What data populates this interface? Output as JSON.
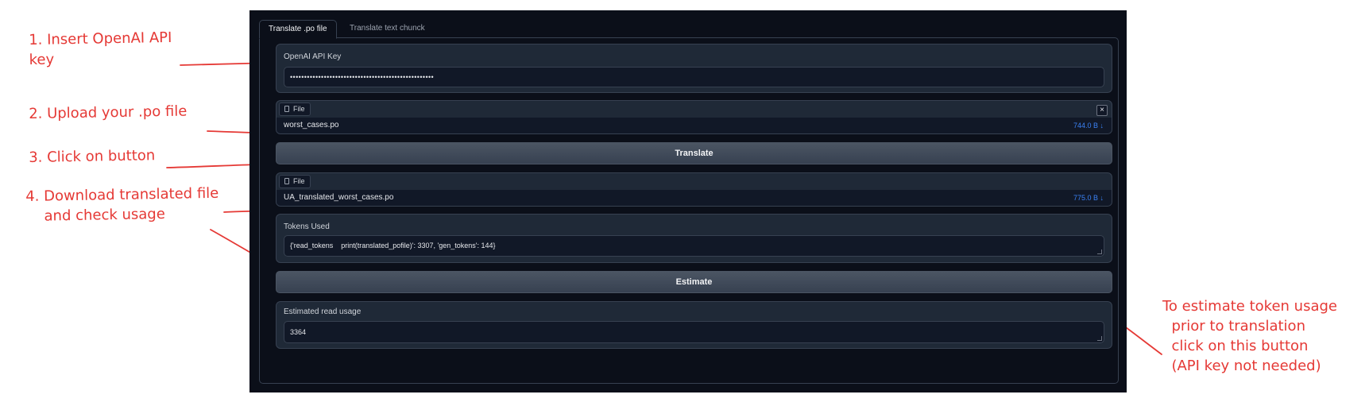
{
  "tabs": [
    {
      "label": "Translate .po file",
      "active": true
    },
    {
      "label": "Translate text chunck",
      "active": false
    }
  ],
  "api_key": {
    "label": "OpenAI API Key",
    "value": "•••••••••••••••••••••••••••••••••••••••••••••••••••"
  },
  "upload": {
    "chip_label": "File",
    "filename": "worst_cases.po",
    "size": "744.0 B ↓",
    "close": "×"
  },
  "translate_button": "Translate",
  "download": {
    "chip_label": "File",
    "filename": "UA_translated_worst_cases.po",
    "size": "775.0 B ↓"
  },
  "tokens": {
    "label": "Tokens Used",
    "value": "{'read_tokens    print(translated_pofile)': 3307, 'gen_tokens': 144}"
  },
  "estimate_button": "Estimate",
  "estimated": {
    "label": "Estimated read usage",
    "value": "3364"
  },
  "annotations": {
    "step1": "1. Insert OpenAI API\nkey",
    "step2": "2. Upload your .po file",
    "step3": "3. Click on button",
    "step4": "4. Download translated file\n    and check usage",
    "estimate_note": "To estimate token usage\n  prior to translation\n  click on this button\n  (API key not needed)"
  },
  "colors": {
    "annotation": "#e53935",
    "app_bg": "#0b0f19",
    "block_bg": "#1f2937",
    "link": "#3b82f6"
  }
}
